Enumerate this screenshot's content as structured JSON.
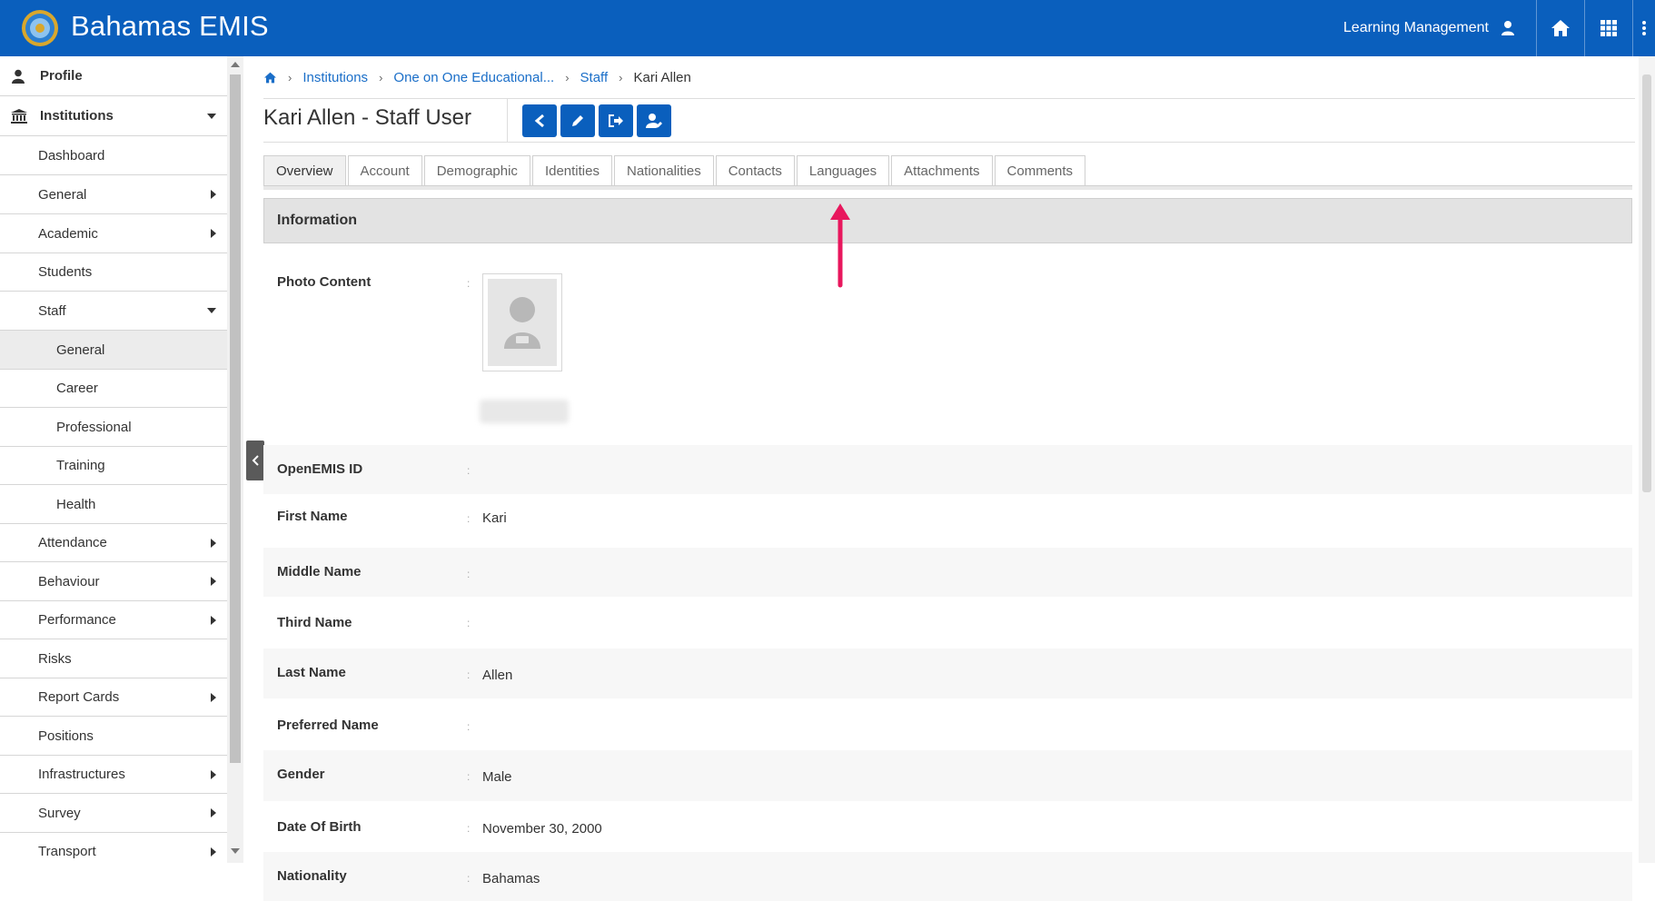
{
  "app": {
    "title": "Bahamas EMIS",
    "top_menu_label": "Learning Management"
  },
  "sidebar": {
    "items": [
      {
        "label": "Profile"
      },
      {
        "label": "Institutions"
      },
      {
        "label": "Dashboard"
      },
      {
        "label": "General"
      },
      {
        "label": "Academic"
      },
      {
        "label": "Students"
      },
      {
        "label": "Staff"
      },
      {
        "label": "General"
      },
      {
        "label": "Career"
      },
      {
        "label": "Professional"
      },
      {
        "label": "Training"
      },
      {
        "label": "Health"
      },
      {
        "label": "Attendance"
      },
      {
        "label": "Behaviour"
      },
      {
        "label": "Performance"
      },
      {
        "label": "Risks"
      },
      {
        "label": "Report Cards"
      },
      {
        "label": "Positions"
      },
      {
        "label": "Infrastructures"
      },
      {
        "label": "Survey"
      },
      {
        "label": "Transport"
      }
    ]
  },
  "breadcrumb": {
    "items": [
      "Institutions",
      "One on One Educational...",
      "Staff"
    ],
    "current": "Kari Allen"
  },
  "page": {
    "title": "Kari Allen - Staff User"
  },
  "tabs": [
    "Overview",
    "Account",
    "Demographic",
    "Identities",
    "Nationalities",
    "Contacts",
    "Languages",
    "Attachments",
    "Comments"
  ],
  "section": {
    "title": "Information"
  },
  "fields": [
    {
      "label": "Photo Content",
      "value": ""
    },
    {
      "label": "OpenEMIS ID",
      "value": ""
    },
    {
      "label": "First Name",
      "value": "Kari"
    },
    {
      "label": "Middle Name",
      "value": ""
    },
    {
      "label": "Third Name",
      "value": ""
    },
    {
      "label": "Last Name",
      "value": "Allen"
    },
    {
      "label": "Preferred Name",
      "value": ""
    },
    {
      "label": "Gender",
      "value": "Male"
    },
    {
      "label": "Date Of Birth",
      "value": "November 30, 2000"
    },
    {
      "label": "Nationality",
      "value": "Bahamas"
    }
  ],
  "colors": {
    "brand": "#0a5fbd",
    "link": "#1a6ec8",
    "annotation_arrow": "#e8175d"
  }
}
